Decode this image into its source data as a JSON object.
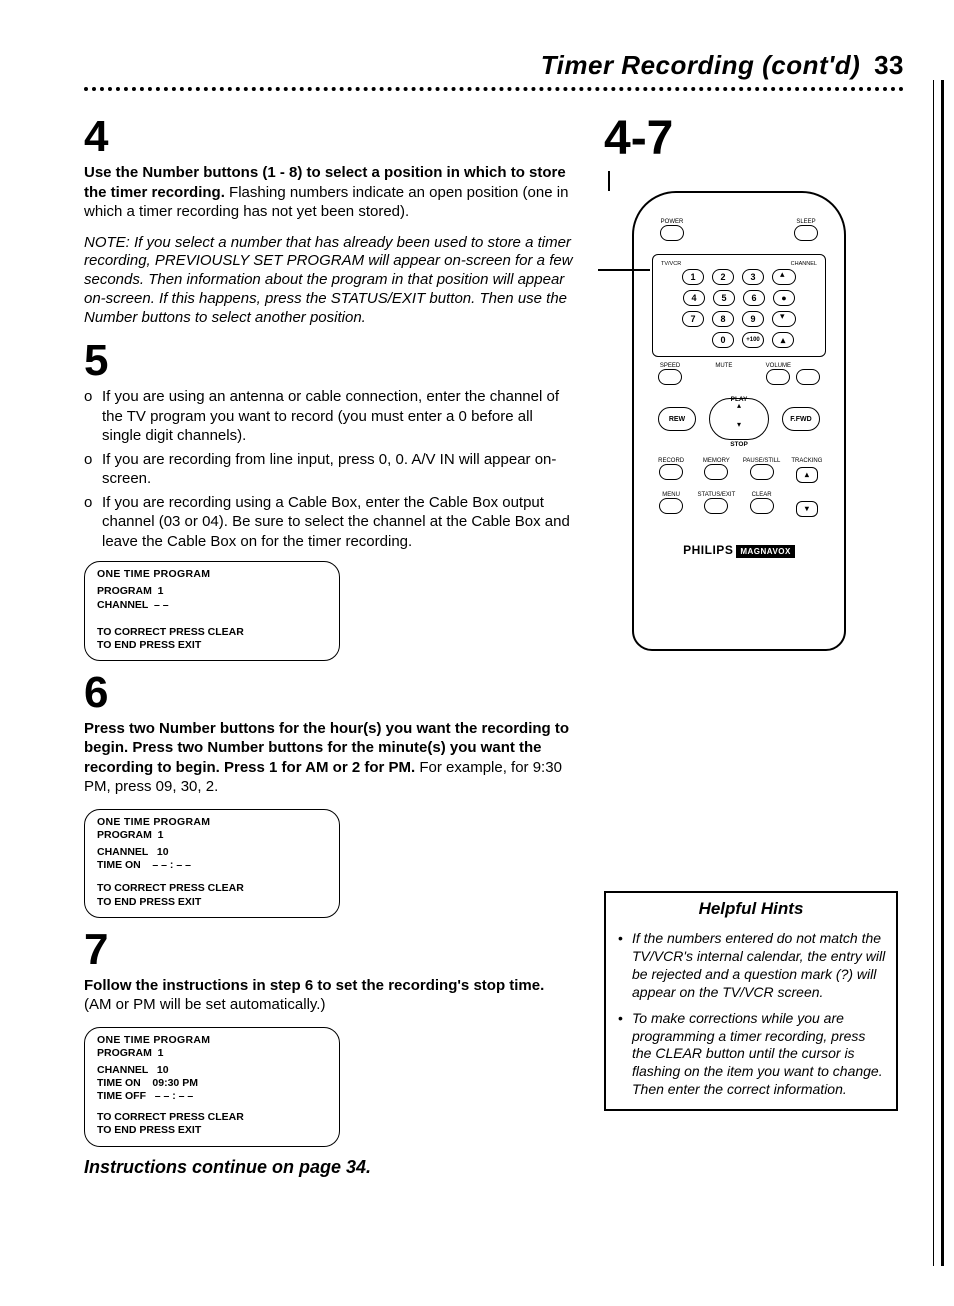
{
  "header": {
    "title": "Timer Recording (cont'd)",
    "page": "33"
  },
  "range_label": "4-7",
  "steps": {
    "4": {
      "num": "4",
      "bold": "Use the Number buttons (1 - 8) to select a position in which to store the timer recording.",
      "rest": " Flashing numbers indicate an open position (one in which a timer recording has not yet been stored).",
      "note": "NOTE: If you select a number that has already been used to store a timer recording, PREVIOUSLY SET PROGRAM will appear on-screen for a few seconds. Then information about the program in that position will appear on-screen. If this happens, press the STATUS/EXIT button. Then use the Number buttons to select another position."
    },
    "5": {
      "num": "5",
      "items": [
        "If you are using an antenna or cable connection, enter the channel of the TV program you want to record (you must enter a 0 before all single digit channels).",
        "If you are recording from line input, press 0, 0. A/V IN will appear on-screen.",
        "If you are recording using a Cable Box, enter the Cable Box output channel (03 or 04). Be sure to select the channel at the Cable Box and leave the Cable Box on for the timer recording."
      ]
    },
    "6": {
      "num": "6",
      "bold": "Press two Number buttons for the hour(s) you want the recording to begin. Press two Number buttons for the minute(s) you want the recording to begin. Press 1 for AM or 2 for PM.",
      "rest": " For example, for 9:30 PM, press 09, 30, 2."
    },
    "7": {
      "num": "7",
      "bold": "Follow the instructions in step 6 to set the recording's stop time.",
      "rest": " (AM or PM will be set automatically.)"
    }
  },
  "osd1": {
    "title": "ONE TIME PROGRAM",
    "lines": [
      "PROGRAM  1",
      "CHANNEL  – –"
    ],
    "foot": [
      "TO CORRECT PRESS CLEAR",
      "TO END PRESS EXIT"
    ]
  },
  "osd2": {
    "title": "ONE TIME PROGRAM",
    "lines": [
      "PROGRAM  1",
      "CHANNEL   10",
      "TIME ON    – – : – –"
    ],
    "foot": [
      "TO CORRECT PRESS CLEAR",
      "TO END PRESS EXIT"
    ]
  },
  "osd3": {
    "title": "ONE TIME PROGRAM",
    "lines": [
      "PROGRAM  1",
      "CHANNEL   10",
      "TIME ON    09:30 PM",
      "TIME OFF   – – : – –"
    ],
    "foot": [
      "TO CORRECT PRESS CLEAR",
      "TO END PRESS EXIT"
    ]
  },
  "continue": "Instructions continue on page 34.",
  "remote": {
    "power": "POWER",
    "sleep": "SLEEP",
    "row_labels": {
      "tvvcr": "TV/VCR",
      "channel": "CHANNEL"
    },
    "nums": [
      "1",
      "2",
      "3",
      "4",
      "5",
      "6",
      "7",
      "8",
      "9",
      "0",
      "+100"
    ],
    "speed": "SPEED",
    "mute": "MUTE",
    "volume": "VOLUME",
    "play": "PLAY",
    "rew": "REW",
    "ffwd": "F.FWD",
    "stop": "STOP",
    "row_bottom1": [
      "RECORD",
      "MEMORY",
      "PAUSE/STILL"
    ],
    "row_bottom2": [
      "MENU",
      "STATUS/EXIT",
      "CLEAR"
    ],
    "tracking": "TRACKING",
    "brand1": "PHILIPS",
    "brand2": "MAGNAVOX"
  },
  "hints": {
    "title": "Helpful Hints",
    "items": [
      "If the numbers entered do not match the TV/VCR's internal calendar, the entry will be rejected and a question mark (?) will appear on the TV/VCR screen.",
      "To make corrections while you are programming a timer recording, press the CLEAR button until the cursor is flashing on the item you want to change. Then enter the correct information."
    ]
  }
}
